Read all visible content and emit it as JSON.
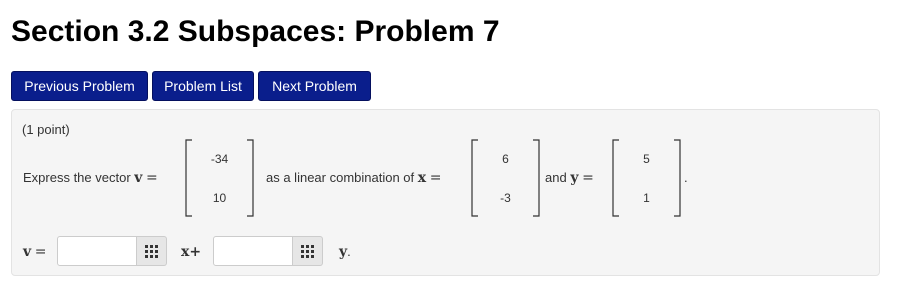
{
  "page": {
    "title": "Section 3.2 Subspaces: Problem 7"
  },
  "nav": {
    "previous_label": "Previous Problem",
    "list_label": "Problem List",
    "next_label": "Next Problem",
    "button_color": "#0a1e8c"
  },
  "problem": {
    "points": "(1 point)",
    "express_text": "Express the vector",
    "v_symbol": "v",
    "equals": "=",
    "combo_text": "as a linear combination of",
    "x_symbol": "x",
    "and_text": "and",
    "y_symbol": "y",
    "period": ".",
    "vectors": {
      "v": [
        "-34",
        "10"
      ],
      "x": [
        "6",
        "-3"
      ],
      "y": [
        "5",
        "1"
      ]
    }
  },
  "answer": {
    "v_symbol": "v",
    "equals": "=",
    "coef1_value": "",
    "coef2_value": "",
    "plus_x": "x+",
    "y_end": "y",
    "y_period": ".",
    "palette_icon": "grid-palette-icon"
  }
}
